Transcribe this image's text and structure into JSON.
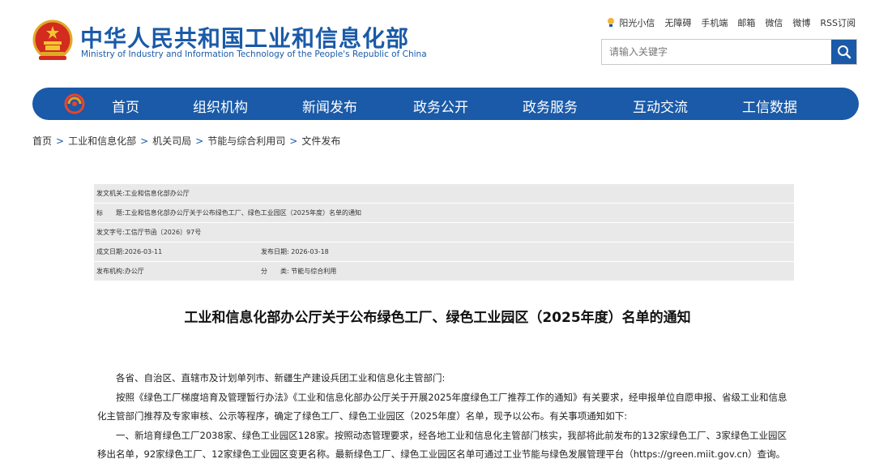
{
  "site": {
    "title": "中华人民共和国工业和信息化部",
    "subtitle": "Ministry of Industry and Information Technology of the People's Republic of China"
  },
  "top_links": [
    "阳光小信",
    "无障碍",
    "手机端",
    "邮箱",
    "微信",
    "微博",
    "RSS订阅"
  ],
  "search": {
    "placeholder": "请输入关键字",
    "icon": "search-icon"
  },
  "nav": {
    "items": [
      "首页",
      "组织机构",
      "新闻发布",
      "政务公开",
      "政务服务",
      "互动交流",
      "工信数据"
    ]
  },
  "breadcrumb": [
    "首页",
    "工业和信息化部",
    "机关司局",
    "节能与综合利用司",
    "文件发布"
  ],
  "meta": {
    "issuer_label": "发文机关:",
    "issuer": "工业和信息化部办公厅",
    "title_label": "标　　题:",
    "title": "工业和信息化部办公厅关于公布绿色工厂、绿色工业园区（2025年度）名单的通知",
    "doc_no_label": "发文字号:",
    "doc_no": "工信厅节函〔2026〕97号",
    "written_label": "成文日期:",
    "written": "2026-03-11",
    "published_label": "发布日期:",
    "published": "2026-03-18",
    "org_label": "发布机构:",
    "org": "办公厅",
    "category_label": "分　　类:",
    "category": "节能与综合利用"
  },
  "document": {
    "title": "工业和信息化部办公厅关于公布绿色工厂、绿色工业园区（2025年度）名单的通知",
    "salutation": "各省、自治区、直辖市及计划单列市、新疆生产建设兵团工业和信息化主管部门:",
    "paragraph1": "按照《绿色工厂梯度培育及管理暂行办法》《工业和信息化部办公厅关于开展2025年度绿色工厂推荐工作的通知》有关要求，经申报单位自愿申报、省级工业和信息化主管部门推荐及专家审核、公示等程序，确定了绿色工厂、绿色工业园区（2025年度）名单，现予以公布。有关事项通知如下:",
    "paragraph2": "一、新培育绿色工厂2038家、绿色工业园区128家。按照动态管理要求，经各地工业和信息化主管部门核实，我部将此前发布的132家绿色工厂、3家绿色工业园区移出名单，92家绿色工厂、12家绿色工业园区变更名称。最新绿色工厂、绿色工业园区名单可通过工业节能与绿色发展管理平台（https://green.miit.gov.cn）查询。"
  },
  "colors": {
    "brand_blue": "#1a5aa8",
    "meta_bg": "#e9e9e9"
  }
}
